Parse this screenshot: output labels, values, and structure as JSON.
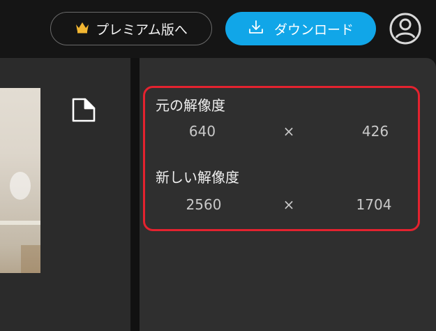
{
  "header": {
    "premium_label": "プレミアム版へ",
    "download_label": "ダウンロード"
  },
  "icons": {
    "crown": "crown-icon",
    "download": "download-icon",
    "user": "user-avatar-icon",
    "page_corner": "page-corner-icon"
  },
  "colors": {
    "download_accent": "#11a6e8",
    "highlight_border": "#e4222f",
    "crown": "#f2b632"
  },
  "resolution": {
    "original": {
      "title": "元の解像度",
      "width": "640",
      "separator": "×",
      "height": "426"
    },
    "new": {
      "title": "新しい解像度",
      "width": "2560",
      "separator": "×",
      "height": "1704"
    }
  }
}
